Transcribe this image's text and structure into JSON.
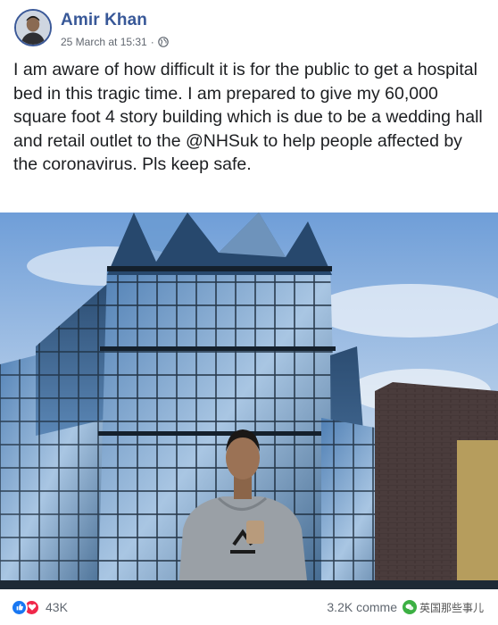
{
  "post": {
    "author": "Amir Khan",
    "timestamp": "25 March at 15:31",
    "separator": "·",
    "privacy_icon": "globe-icon",
    "text": "I am aware of how difficult it is for the public to get a hospital bed in this tragic time. I am prepared to give my 60,000 square foot 4 story building which is due to be a wedding hall and retail outlet to the @NHSuk to help people affected by the coronavirus. Pls keep safe."
  },
  "footer": {
    "reaction_icons": [
      "like-icon",
      "love-icon"
    ],
    "reaction_count": "43K",
    "comments_text": "3.2K comme",
    "watermark_text": "英国那些事儿"
  },
  "colors": {
    "author_blue": "#385898",
    "like_blue": "#1877f2",
    "love_red": "#f0284a",
    "meta_grey": "#616770"
  }
}
